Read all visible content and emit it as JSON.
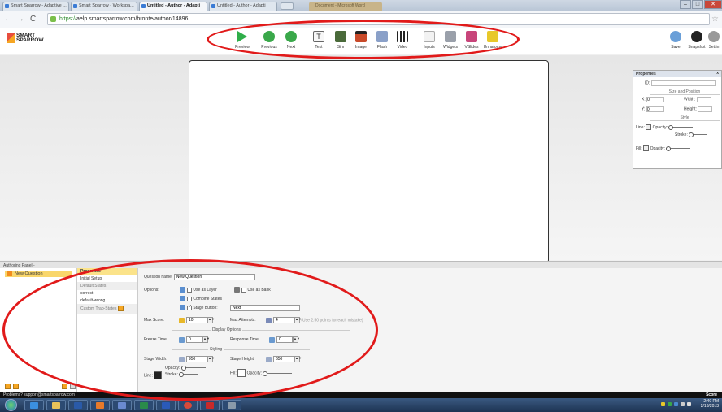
{
  "browser": {
    "tabs": [
      {
        "label": "Smart Sparrow - Adaptive ...",
        "active": false
      },
      {
        "label": "Smart Sparrow - Workspa...",
        "active": false
      },
      {
        "label": "Untitled - Author - Adapti",
        "active": true
      },
      {
        "label": "Untitled - Author - Adapti",
        "active": false
      }
    ],
    "hidden_tab": "Document - Microsoft Word",
    "url_scheme": "https://",
    "url_rest": "aelp.smartsparrow.com/bronte/author/14896"
  },
  "app": {
    "logo_line1": "SMART",
    "logo_line2": "SPARROW",
    "tools": [
      {
        "id": "preview",
        "label": "Preview",
        "icon": "play-icon",
        "color": "#2fae4a"
      },
      {
        "id": "previous",
        "label": "Previous",
        "icon": "previous-icon",
        "color": "#3aa84a"
      },
      {
        "id": "next",
        "label": "Next",
        "icon": "next-icon",
        "color": "#3aa84a"
      },
      {
        "id": "text",
        "label": "Text",
        "icon": "text-icon",
        "color": "#f7f7f7"
      },
      {
        "id": "sim",
        "label": "Sim",
        "icon": "sim-icon",
        "color": "#4a6a3a"
      },
      {
        "id": "image",
        "label": "Image",
        "icon": "image-icon",
        "color": "#c84a2a"
      },
      {
        "id": "flash",
        "label": "Flash",
        "icon": "flash-icon",
        "color": "#8aa0c8"
      },
      {
        "id": "video",
        "label": "Video",
        "icon": "video-icon",
        "color": "#222222"
      },
      {
        "id": "inputs",
        "label": "Inputs",
        "icon": "inputs-icon",
        "color": "#bbbbbb"
      },
      {
        "id": "widgets",
        "label": "Widgets",
        "icon": "widgets-icon",
        "color": "#9aa0aa"
      },
      {
        "id": "vslides",
        "label": "VSlides",
        "icon": "vslides-icon",
        "color": "#c8457a"
      },
      {
        "id": "unnatomy",
        "label": "Unnatomy",
        "icon": "unnatomy-icon",
        "color": "#e8c82a"
      }
    ],
    "right_tools": [
      {
        "label": "Save",
        "icon": "save-icon"
      },
      {
        "label": "Snapshot",
        "icon": "snapshot-icon"
      },
      {
        "label": "Settin",
        "icon": "settings-icon"
      }
    ]
  },
  "properties": {
    "title": "Properties",
    "close": "x",
    "id_label": "ID:",
    "section_size": "Size and Position",
    "x_label": "X:",
    "x_value": "0",
    "y_label": "Y:",
    "y_value": "0",
    "width_label": "Width:",
    "height_label": "Height:",
    "section_style": "Style",
    "line_label": "Line:",
    "opacity_label": "Opacity:",
    "stroke_label": "Stroke:",
    "fill_label": "Fill:",
    "fill_opacity_label": "Opacity:"
  },
  "authoring": {
    "bar_title": "Authoring Panel -",
    "question_item": "New Question",
    "nav": {
      "properties": "Properties",
      "initial_setup": "Initial Setup",
      "default_states": "Default States",
      "correct": "correct",
      "default_wrong": "default-wrong",
      "custom_trap_states": "Custom Trap-States"
    },
    "form": {
      "question_name_label": "Question name:",
      "question_name_value": "New Question",
      "options_label": "Options:",
      "use_as_layer": "Use as Layer",
      "use_as_bank": "Use as Bank",
      "combine_states": "Combine States",
      "stage_button": "Stage Button:",
      "stage_button_value": "Next",
      "max_score_label": "Max Score:",
      "max_score_value": "10",
      "max_attempts_label": "Max Attempts:",
      "max_attempts_value": "4",
      "max_attempts_hint": "(Use 2.50 points for each mistake)",
      "display_options": "Display Options",
      "freeze_time_label": "Freeze Time:",
      "freeze_time_value": "0",
      "response_time_label": "Response Time:",
      "response_time_value": "0",
      "styling": "Styling",
      "stage_width_label": "Stage Width:",
      "stage_width_value": "950",
      "stage_height_label": "Stage Height:",
      "stage_height_value": "650",
      "opacity_label": "Opacity:",
      "line_label": "Line:",
      "stroke_label": "Stroke:",
      "fill_label": "Fill:",
      "fill_opacity_label": "Opacity:"
    }
  },
  "status": {
    "problems": "Problems? support@smartsparrow.com",
    "score": "Score"
  },
  "taskbar": {
    "time": "2:40 PM",
    "date": "2/13/2013"
  }
}
